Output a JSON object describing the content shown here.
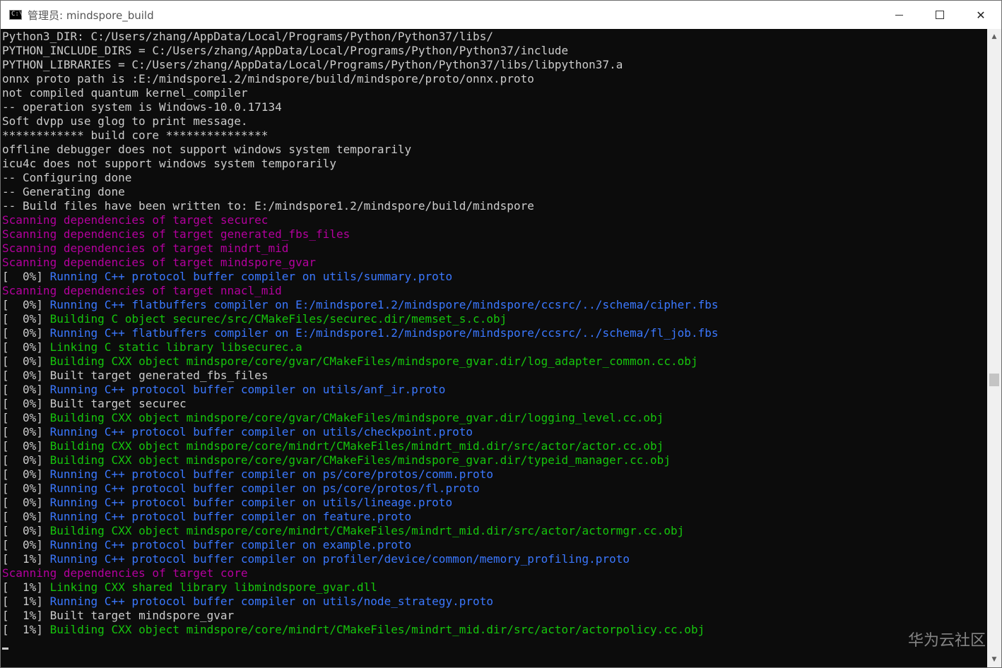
{
  "window": {
    "title": "管理员: mindspore_build",
    "minimize_label": "",
    "maximize_label": "",
    "close_label": "✕",
    "app_icon_text": "C:\\"
  },
  "colors": {
    "white": "#cccccc",
    "magenta": "#b4009e",
    "blue": "#3b78ff",
    "green": "#16c60c"
  },
  "console": {
    "lines": [
      {
        "prefix": "",
        "text": "Python3_DIR: C:/Users/zhang/AppData/Local/Programs/Python/Python37/libs/",
        "color": "w"
      },
      {
        "prefix": "",
        "text": "PYTHON_INCLUDE_DIRS = C:/Users/zhang/AppData/Local/Programs/Python/Python37/include",
        "color": "w"
      },
      {
        "prefix": "",
        "text": "PYTHON_LIBRARIES = C:/Users/zhang/AppData/Local/Programs/Python/Python37/libs/libpython37.a",
        "color": "w"
      },
      {
        "prefix": "",
        "text": "onnx proto path is :E:/mindspore1.2/mindspore/build/mindspore/proto/onnx.proto",
        "color": "w"
      },
      {
        "prefix": "",
        "text": "not compiled quantum kernel_compiler",
        "color": "w"
      },
      {
        "prefix": "",
        "text": "-- operation system is Windows-10.0.17134",
        "color": "w"
      },
      {
        "prefix": "",
        "text": "Soft dvpp use glog to print message.",
        "color": "w"
      },
      {
        "prefix": "",
        "text": "************ build core ***************",
        "color": "w"
      },
      {
        "prefix": "",
        "text": "offline debugger does not support windows system temporarily",
        "color": "w"
      },
      {
        "prefix": "",
        "text": "icu4c does not support windows system temporarily",
        "color": "w"
      },
      {
        "prefix": "",
        "text": "-- Configuring done",
        "color": "w"
      },
      {
        "prefix": "",
        "text": "-- Generating done",
        "color": "w"
      },
      {
        "prefix": "",
        "text": "-- Build files have been written to: E:/mindspore1.2/mindspore/build/mindspore",
        "color": "w"
      },
      {
        "prefix": "",
        "text": "Scanning dependencies of target securec",
        "color": "m"
      },
      {
        "prefix": "",
        "text": "Scanning dependencies of target generated_fbs_files",
        "color": "m"
      },
      {
        "prefix": "",
        "text": "Scanning dependencies of target mindrt_mid",
        "color": "m"
      },
      {
        "prefix": "",
        "text": "Scanning dependencies of target mindspore_gvar",
        "color": "m"
      },
      {
        "prefix": "[  0%] ",
        "text": "Running C++ protocol buffer compiler on utils/summary.proto",
        "color": "b"
      },
      {
        "prefix": "",
        "text": "Scanning dependencies of target nnacl_mid",
        "color": "m"
      },
      {
        "prefix": "[  0%] ",
        "text": "Running C++ flatbuffers compiler on E:/mindspore1.2/mindspore/mindspore/ccsrc/../schema/cipher.fbs",
        "color": "b"
      },
      {
        "prefix": "[  0%] ",
        "text": "Building C object securec/src/CMakeFiles/securec.dir/memset_s.c.obj",
        "color": "g"
      },
      {
        "prefix": "[  0%] ",
        "text": "Running C++ flatbuffers compiler on E:/mindspore1.2/mindspore/mindspore/ccsrc/../schema/fl_job.fbs",
        "color": "b"
      },
      {
        "prefix": "[  0%] ",
        "text": "Linking C static library libsecurec.a",
        "color": "g"
      },
      {
        "prefix": "[  0%] ",
        "text": "Building CXX object mindspore/core/gvar/CMakeFiles/mindspore_gvar.dir/log_adapter_common.cc.obj",
        "color": "g"
      },
      {
        "prefix": "[  0%] ",
        "text": "Built target generated_fbs_files",
        "color": "w"
      },
      {
        "prefix": "[  0%] ",
        "text": "Running C++ protocol buffer compiler on utils/anf_ir.proto",
        "color": "b"
      },
      {
        "prefix": "[  0%] ",
        "text": "Built target securec",
        "color": "w"
      },
      {
        "prefix": "[  0%] ",
        "text": "Building CXX object mindspore/core/gvar/CMakeFiles/mindspore_gvar.dir/logging_level.cc.obj",
        "color": "g"
      },
      {
        "prefix": "[  0%] ",
        "text": "Running C++ protocol buffer compiler on utils/checkpoint.proto",
        "color": "b"
      },
      {
        "prefix": "[  0%] ",
        "text": "Building CXX object mindspore/core/mindrt/CMakeFiles/mindrt_mid.dir/src/actor/actor.cc.obj",
        "color": "g"
      },
      {
        "prefix": "[  0%] ",
        "text": "Building CXX object mindspore/core/gvar/CMakeFiles/mindspore_gvar.dir/typeid_manager.cc.obj",
        "color": "g"
      },
      {
        "prefix": "[  0%] ",
        "text": "Running C++ protocol buffer compiler on ps/core/protos/comm.proto",
        "color": "b"
      },
      {
        "prefix": "[  0%] ",
        "text": "Running C++ protocol buffer compiler on ps/core/protos/fl.proto",
        "color": "b"
      },
      {
        "prefix": "[  0%] ",
        "text": "Running C++ protocol buffer compiler on utils/lineage.proto",
        "color": "b"
      },
      {
        "prefix": "[  0%] ",
        "text": "Running C++ protocol buffer compiler on feature.proto",
        "color": "b"
      },
      {
        "prefix": "[  0%] ",
        "text": "Building CXX object mindspore/core/mindrt/CMakeFiles/mindrt_mid.dir/src/actor/actormgr.cc.obj",
        "color": "g"
      },
      {
        "prefix": "[  0%] ",
        "text": "Running C++ protocol buffer compiler on example.proto",
        "color": "b"
      },
      {
        "prefix": "[  1%] ",
        "text": "Running C++ protocol buffer compiler on profiler/device/common/memory_profiling.proto",
        "color": "b"
      },
      {
        "prefix": "",
        "text": "Scanning dependencies of target core",
        "color": "m"
      },
      {
        "prefix": "[  1%] ",
        "text": "Linking CXX shared library libmindspore_gvar.dll",
        "color": "g"
      },
      {
        "prefix": "[  1%] ",
        "text": "Running C++ protocol buffer compiler on utils/node_strategy.proto",
        "color": "b"
      },
      {
        "prefix": "[  1%] ",
        "text": "Built target mindspore_gvar",
        "color": "w"
      },
      {
        "prefix": "[  1%] ",
        "text": "Building CXX object mindspore/core/mindrt/CMakeFiles/mindrt_mid.dir/src/actor/actorpolicy.cc.obj",
        "color": "g"
      }
    ]
  },
  "scrollbar": {
    "up_arrow": "▲",
    "down_arrow": "▼"
  },
  "watermark": "华为云社区"
}
